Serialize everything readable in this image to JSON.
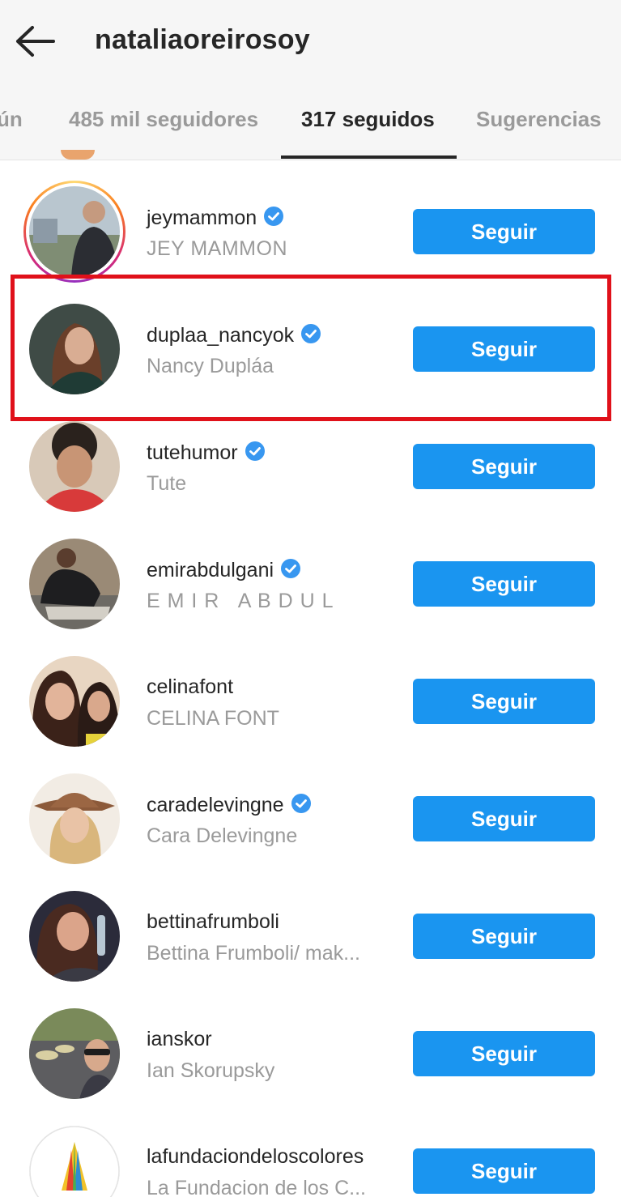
{
  "header": {
    "title": "nataliaoreirosoy"
  },
  "tabs": [
    {
      "label": "ún"
    },
    {
      "label": "485 mil seguidores"
    },
    {
      "label": "317 seguidos"
    },
    {
      "label": "Sugerencias"
    }
  ],
  "colors": {
    "accent": "#1a95f0",
    "highlight": "#e0111a"
  },
  "icons": {
    "back": "arrow-left-icon",
    "verified": "verified-badge-icon"
  },
  "list": [
    {
      "username": "jeymammon",
      "fullname": "JEY MAMMON",
      "verified": true,
      "button": "Seguir"
    },
    {
      "username": "duplaa_nancyok",
      "fullname": "Nancy Dupláa",
      "verified": true,
      "button": "Seguir"
    },
    {
      "username": "tutehumor",
      "fullname": "Tute",
      "verified": true,
      "button": "Seguir"
    },
    {
      "username": "emirabdulgani",
      "fullname": "E M I R   A B D U L",
      "verified": true,
      "button": "Seguir"
    },
    {
      "username": "celinafont",
      "fullname": "CELINA FONT",
      "verified": false,
      "button": "Seguir"
    },
    {
      "username": "caradelevingne",
      "fullname": "Cara Delevingne",
      "verified": true,
      "button": "Seguir"
    },
    {
      "username": "bettinafrumboli",
      "fullname": "Bettina Frumboli/ mak...",
      "verified": false,
      "button": "Seguir"
    },
    {
      "username": "ianskor",
      "fullname": "Ian Skorupsky",
      "verified": false,
      "button": "Seguir"
    },
    {
      "username": "lafundaciondeloscolores",
      "fullname": "La Fundacion de los C...",
      "verified": false,
      "button": "Seguir"
    }
  ]
}
